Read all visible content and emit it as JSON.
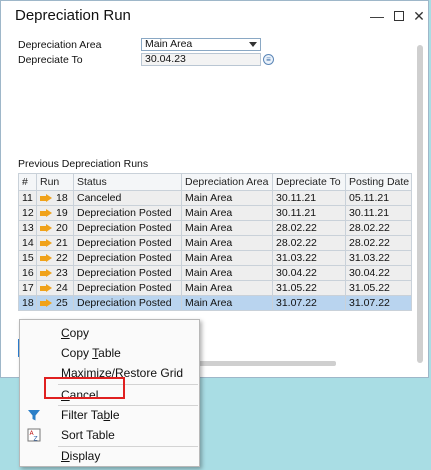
{
  "window": {
    "title": "Depreciation Run",
    "controls": {
      "minimize": "—",
      "close": "✕"
    }
  },
  "form": {
    "depreciation_area_label": "Depreciation Area",
    "depreciation_area_value": "Main Area",
    "depreciate_to_label": "Depreciate To",
    "depreciate_to_value": "30.04.23"
  },
  "previous_runs": {
    "title": "Previous Depreciation Runs",
    "columns": [
      "#",
      "Run",
      "Status",
      "Depreciation Area",
      "Depreciate To",
      "Posting Date"
    ],
    "rows": [
      {
        "num": "11",
        "run": "18",
        "status": "Canceled",
        "area": "Main Area",
        "to": "30.11.21",
        "posting": "05.11.21"
      },
      {
        "num": "12",
        "run": "19",
        "status": "Depreciation Posted",
        "area": "Main Area",
        "to": "30.11.21",
        "posting": "30.11.21"
      },
      {
        "num": "13",
        "run": "20",
        "status": "Depreciation Posted",
        "area": "Main Area",
        "to": "28.02.22",
        "posting": "28.02.22"
      },
      {
        "num": "14",
        "run": "21",
        "status": "Depreciation Posted",
        "area": "Main Area",
        "to": "28.02.22",
        "posting": "28.02.22"
      },
      {
        "num": "15",
        "run": "22",
        "status": "Depreciation Posted",
        "area": "Main Area",
        "to": "31.03.22",
        "posting": "31.03.22"
      },
      {
        "num": "16",
        "run": "23",
        "status": "Depreciation Posted",
        "area": "Main Area",
        "to": "30.04.22",
        "posting": "30.04.22"
      },
      {
        "num": "17",
        "run": "24",
        "status": "Depreciation Posted",
        "area": "Main Area",
        "to": "31.05.22",
        "posting": "31.05.22"
      },
      {
        "num": "18",
        "run": "25",
        "status": "Depreciation Posted",
        "area": "Main Area",
        "to": "31.07.22",
        "posting": "31.07.22"
      }
    ],
    "selected_row": "18"
  },
  "context_menu": {
    "copy": {
      "pre": "",
      "ul": "C",
      "post": "opy"
    },
    "copy_table": {
      "pre": "Copy ",
      "ul": "T",
      "post": "able"
    },
    "maximize": {
      "pre": "",
      "ul": "M",
      "post": "aximize/Restore Grid"
    },
    "cancel": {
      "pre": "",
      "ul": "C",
      "post": "ancel"
    },
    "filter": {
      "pre": "Filter Ta",
      "ul": "b",
      "post": "le"
    },
    "sort": {
      "pre": "Sort Table",
      "ul": "",
      "post": ""
    },
    "display": {
      "pre": "",
      "ul": "D",
      "post": "isplay"
    }
  },
  "colors": {
    "selection": "#b9d4ef",
    "highlight_box": "#e02020",
    "run_arrow": "#f0a21a",
    "filter_icon": "#2b7fc8"
  },
  "icons": [
    "dropdown-arrow-icon",
    "calculator-icon",
    "run-arrow-icon",
    "filter-icon",
    "sort-icon"
  ]
}
